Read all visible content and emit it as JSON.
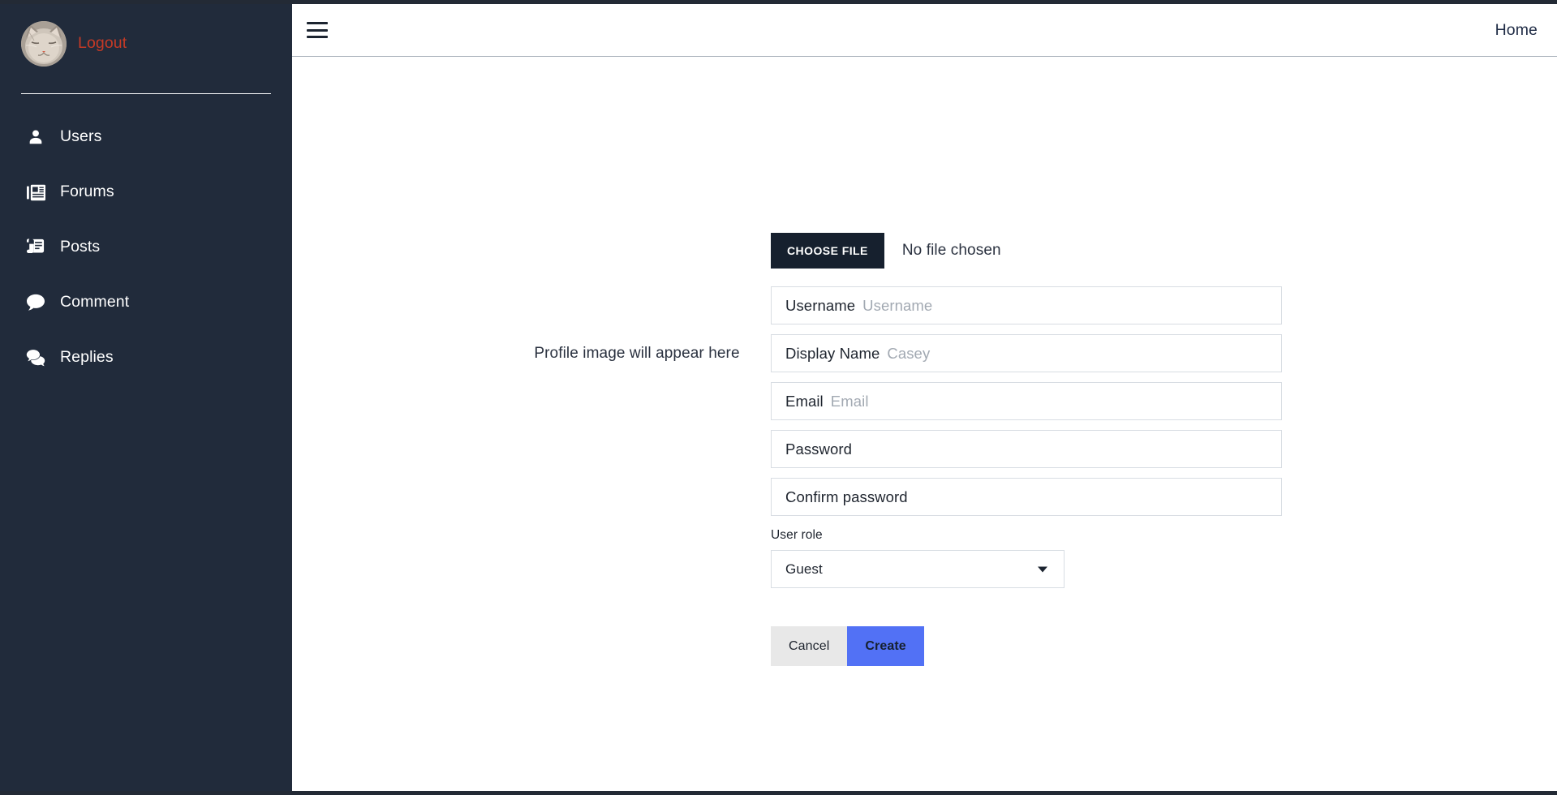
{
  "sidebar": {
    "avatar_alt": "cat-profile-photo",
    "logout_label": "Logout",
    "items": [
      {
        "label": "Users",
        "icon": "user-icon"
      },
      {
        "label": "Forums",
        "icon": "newspaper-icon"
      },
      {
        "label": "Posts",
        "icon": "scroll-icon"
      },
      {
        "label": "Comment",
        "icon": "speech-bubble-icon"
      },
      {
        "label": "Replies",
        "icon": "double-speech-bubble-icon"
      }
    ]
  },
  "header": {
    "menu_icon": "hamburger-icon",
    "home_label": "Home"
  },
  "content": {
    "profile_placeholder": "Profile image will appear here"
  },
  "form": {
    "file": {
      "button_label": "CHOOSE FILE",
      "status_text": "No file chosen"
    },
    "fields": [
      {
        "label": "Username",
        "placeholder": "Username",
        "value": ""
      },
      {
        "label": "Display Name",
        "placeholder": "Casey",
        "value": ""
      },
      {
        "label": "Email",
        "placeholder": "Email",
        "value": ""
      },
      {
        "label": "Password",
        "placeholder": "",
        "value": ""
      },
      {
        "label": "Confirm password",
        "placeholder": "",
        "value": ""
      }
    ],
    "role": {
      "label": "User role",
      "selected": "Guest",
      "caret_icon": "chevron-down-icon"
    },
    "buttons": {
      "cancel": "Cancel",
      "create": "Create"
    }
  },
  "colors": {
    "sidebar_bg": "#212b3b",
    "logout_red": "#c53a26",
    "choose_file_bg": "#16202e",
    "create_blue": "#5271f5",
    "cancel_grey": "#e8e8e8",
    "placeholder_grey": "#a2a9b2",
    "field_border": "#d8dde3"
  }
}
